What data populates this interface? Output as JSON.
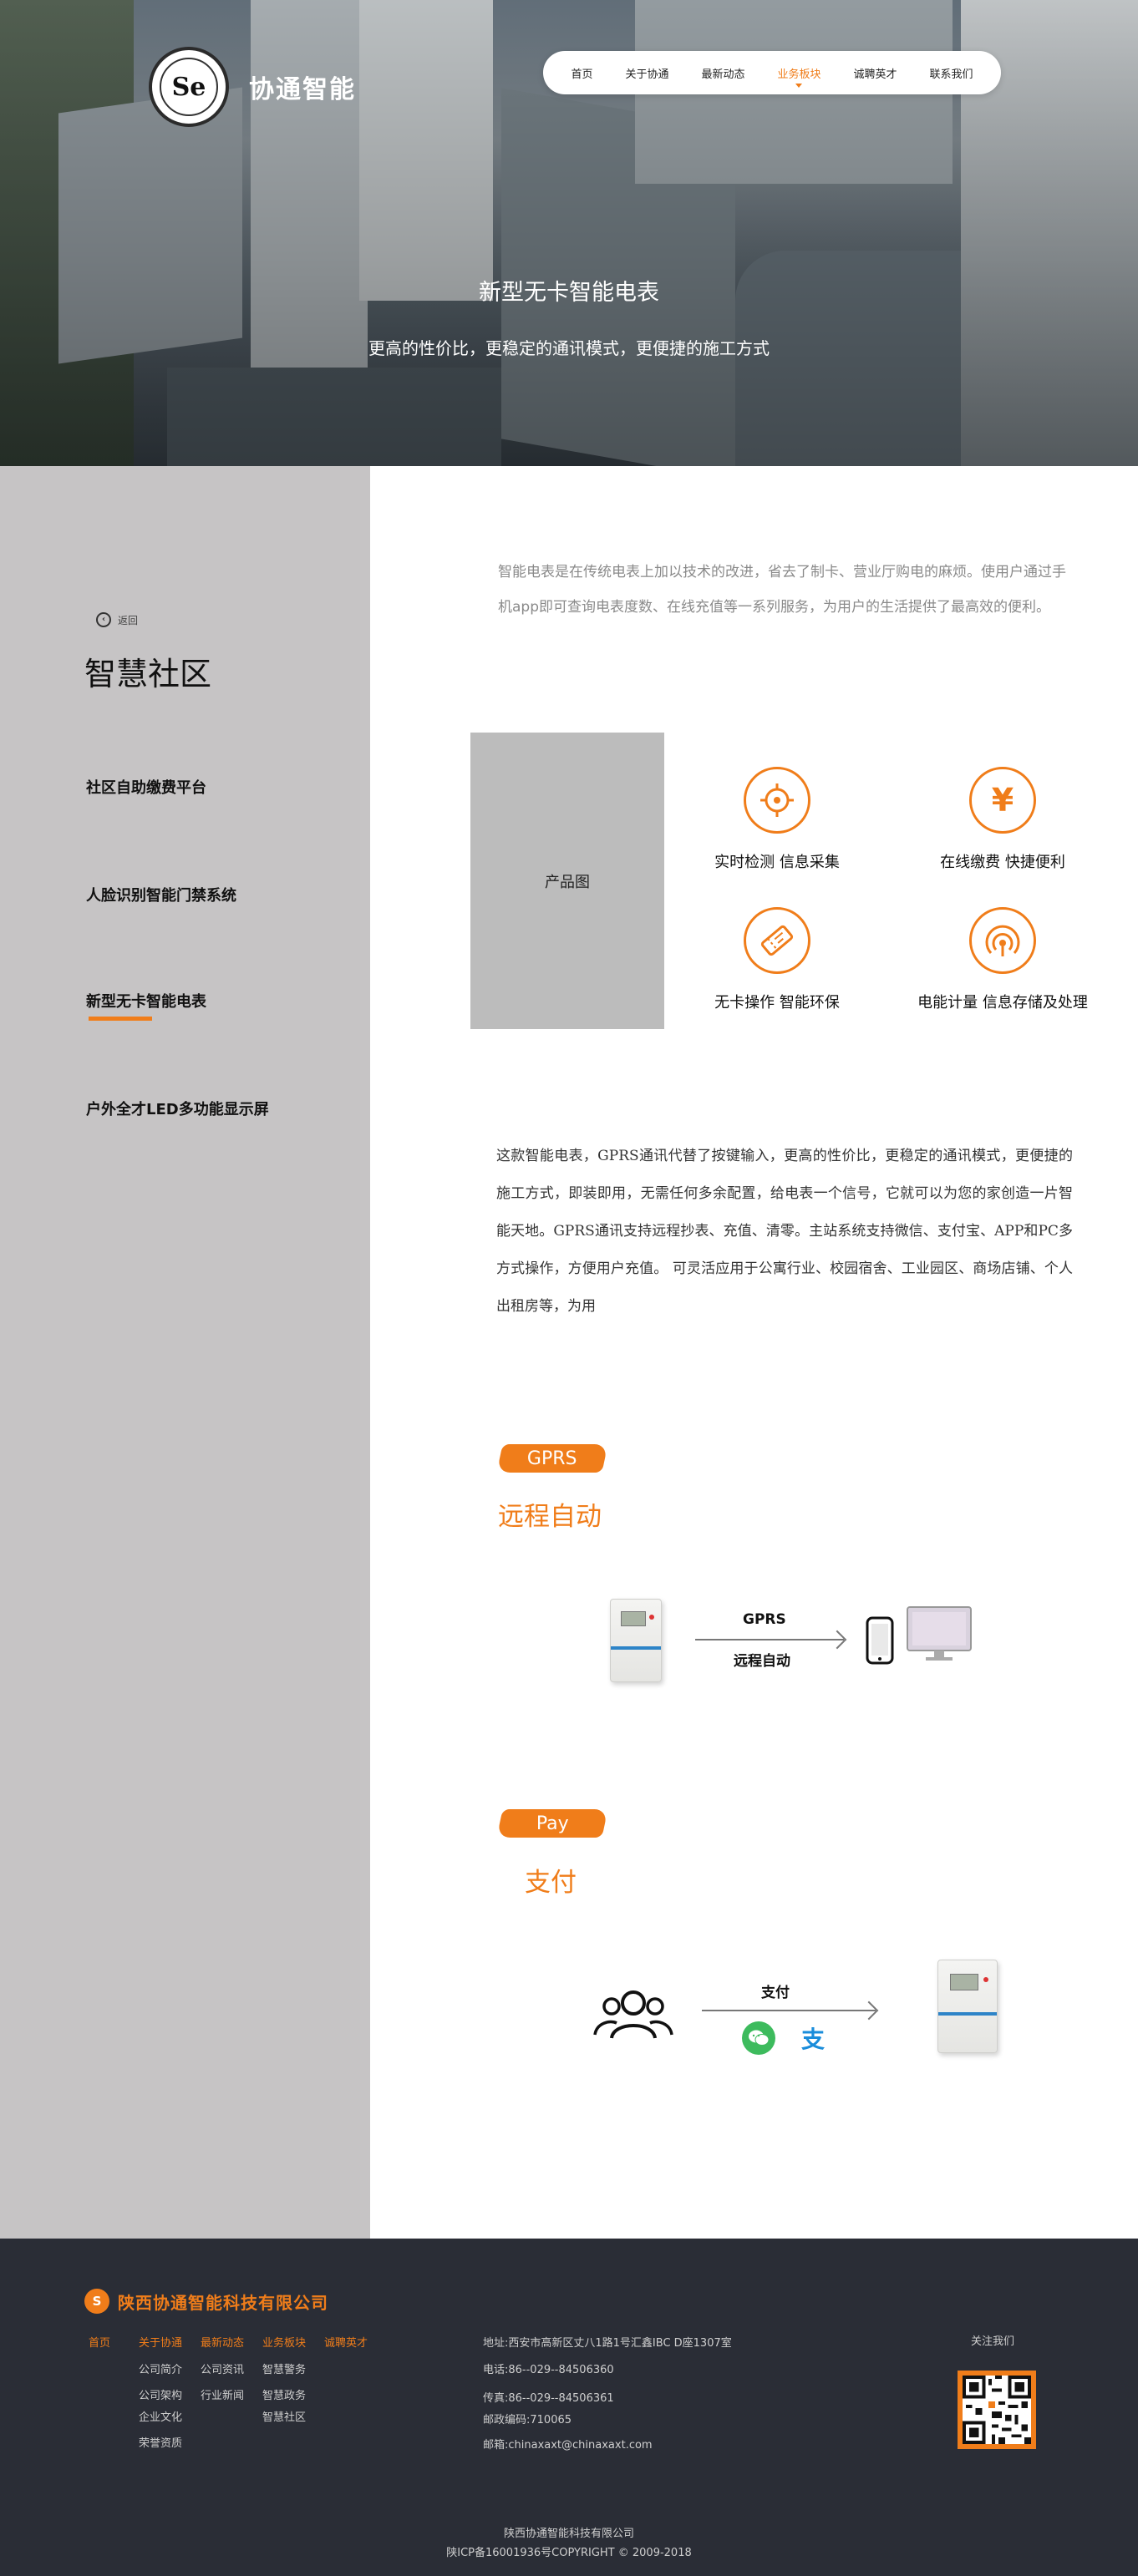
{
  "brand": {
    "name": "协通智能",
    "logo_mark": "Se"
  },
  "nav": {
    "items": [
      {
        "label": "首页"
      },
      {
        "label": "关于协通"
      },
      {
        "label": "最新动态"
      },
      {
        "label": "业务板块"
      },
      {
        "label": "诚聘英才"
      },
      {
        "label": "联系我们"
      }
    ],
    "active_index": 3,
    "accent_color": "#f07d1a"
  },
  "hero": {
    "title": "新型无卡智能电表",
    "subtitle": "更高的性价比，更稳定的通讯模式，更便捷的施工方式"
  },
  "sidebar": {
    "back_label": "返回",
    "title": "智慧社区",
    "items": [
      {
        "label": "社区自助缴费平台"
      },
      {
        "label": "人脸识别智能门禁系统"
      },
      {
        "label": "新型无卡智能电表"
      },
      {
        "label": "户外全才LED多功能显示屏"
      }
    ],
    "active_index": 2
  },
  "main": {
    "intro": "智能电表是在传统电表上加以技术的改进，省去了制卡、营业厅购电的麻烦。使用户通过手机app即可查询电表度数、在线充值等一系列服务，为用户的生活提供了最高效的便利。",
    "product_placeholder": "产品图",
    "features": [
      {
        "label": "实时检测 信息采集",
        "icon": "target-icon"
      },
      {
        "label": "在线缴费 快捷便利",
        "icon": "yen-icon"
      },
      {
        "label": "无卡操作 智能环保",
        "icon": "ticket-icon"
      },
      {
        "label": "电能计量 信息存储及处理",
        "icon": "signal-icon"
      }
    ],
    "description": "这款智能电表，GPRS通讯代替了按键输入，更高的性价比，更稳定的通讯模式，更便捷的施工方式，即装即用，无需任何多余配置，给电表一个信号，它就可以为您的家创造一片智能天地。GPRS通讯支持远程抄表、充值、清零。主站系统支持微信、支付宝、APP和PC多方式操作，方便用户充值。 可灵活应用于公寓行业、校园宿舍、工业园区、商场店铺、个人出租房等，为用",
    "gprs": {
      "tag": "GPRS",
      "title": "远程自动",
      "flow_top": "GPRS",
      "flow_bottom": "远程自动"
    },
    "pay": {
      "tag": "Pay",
      "title": "支付",
      "flow_top": "支付"
    }
  },
  "footer": {
    "company": "陕西协通智能科技有限公司",
    "nav": [
      {
        "label": "首页"
      },
      {
        "label": "关于协通"
      },
      {
        "label": "最新动态"
      },
      {
        "label": "业务板块"
      },
      {
        "label": "诚聘英才"
      }
    ],
    "sub_about": [
      "公司简介",
      "公司架构",
      "企业文化",
      "荣誉资质"
    ],
    "sub_news": [
      "公司资讯",
      "行业新闻"
    ],
    "sub_business": [
      "智慧警务",
      "智慧政务",
      "智慧社区"
    ],
    "contact": {
      "address": "地址:西安市高新区丈八1路1号汇鑫IBC D座1307室",
      "phone": "电话:86--029--84506360",
      "fax": "传真:86--029--84506361",
      "postcode": "邮政编码:710065",
      "email": "邮箱:chinaxaxt@chinaxaxt.com"
    },
    "follow_label": "关注我们",
    "copyright_company": "陕西协通智能科技有限公司",
    "icp": "陕ICP备16001936号COPYRIGHT © 2009-2018"
  }
}
